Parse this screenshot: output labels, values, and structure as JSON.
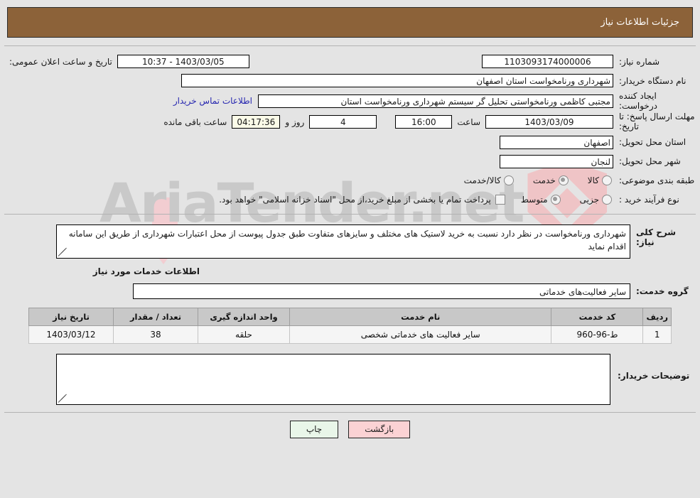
{
  "header": {
    "title": "جزئیات اطلاعات نیاز"
  },
  "watermark": {
    "text": "AriaTender.net",
    "shield_color": "#efc4c6",
    "text_color": "#c9c9c9"
  },
  "info": {
    "need_no_label": "شماره نیاز:",
    "need_no_value": "1103093174000006",
    "public_date_label": "تاریخ و ساعت اعلان عمومی:",
    "public_date_value": "1403/03/05 - 10:37",
    "buyer_org_label": "نام دستگاه خریدار:",
    "buyer_org_value": "شهرداری ورنامخواست استان اصفهان",
    "creator_label": "ایجاد کننده درخواست:",
    "creator_value": "مجتبی کاظمی ورنامخواستی تحلیل گر سیستم  شهرداری ورنامخواست استان",
    "contact_link": "اطلاعات تماس خریدار",
    "deadline_label": "مهلت ارسال پاسخ: تا تاریخ:",
    "deadline_date": "1403/03/09",
    "hour_label": "ساعت",
    "deadline_time": "16:00",
    "days_value": "4",
    "days_label": "روز و",
    "remaining_value": "04:17:36",
    "remaining_label": "ساعت باقی مانده",
    "province_label": "استان محل تحویل:",
    "province_value": "اصفهان",
    "city_label": "شهر محل تحویل:",
    "city_value": "لنجان",
    "category_label": "طبقه بندی موضوعی:",
    "category_options": [
      {
        "label": "کالا",
        "selected": false
      },
      {
        "label": "خدمت",
        "selected": true
      },
      {
        "label": "کالا/خدمت",
        "selected": false
      }
    ],
    "process_label": "نوع فرآیند خرید :",
    "process_options": [
      {
        "label": "جزیی",
        "selected": false
      },
      {
        "label": "متوسط",
        "selected": true
      }
    ],
    "treasury_checked": false,
    "treasury_note": "پرداخت تمام یا بخشی از مبلغ خرید،از محل \"اسناد خزانه اسلامی\" خواهد بود."
  },
  "description": {
    "label": "شرح کلی نیاز:",
    "value": "شهرداری ورنامخواست در نظر دارد نسبت به خرید لاستیک های مختلف و سایزهای متفاوت طبق جدول پیوست از محل اعتبارات شهرداری از طریق این سامانه اقدام نماید"
  },
  "services_section": {
    "title": "اطلاعات خدمات مورد نیاز",
    "group_label": "گروه خدمت:",
    "group_value": "سایر فعالیت‌های خدماتی",
    "columns": [
      "ردیف",
      "کد خدمت",
      "نام خدمت",
      "واحد اندازه گیری",
      "تعداد / مقدار",
      "تاریخ نیاز"
    ],
    "rows": [
      {
        "radif": "1",
        "code": "ط-96-960",
        "name": "سایر فعالیت های خدماتی شخصی",
        "unit": "حلقه",
        "qty": "38",
        "date": "1403/03/12"
      }
    ]
  },
  "buyer_notes": {
    "label": "توضیحات خریدار:",
    "value": ""
  },
  "footer": {
    "print_label": "چاپ",
    "back_label": "بازگشت"
  }
}
